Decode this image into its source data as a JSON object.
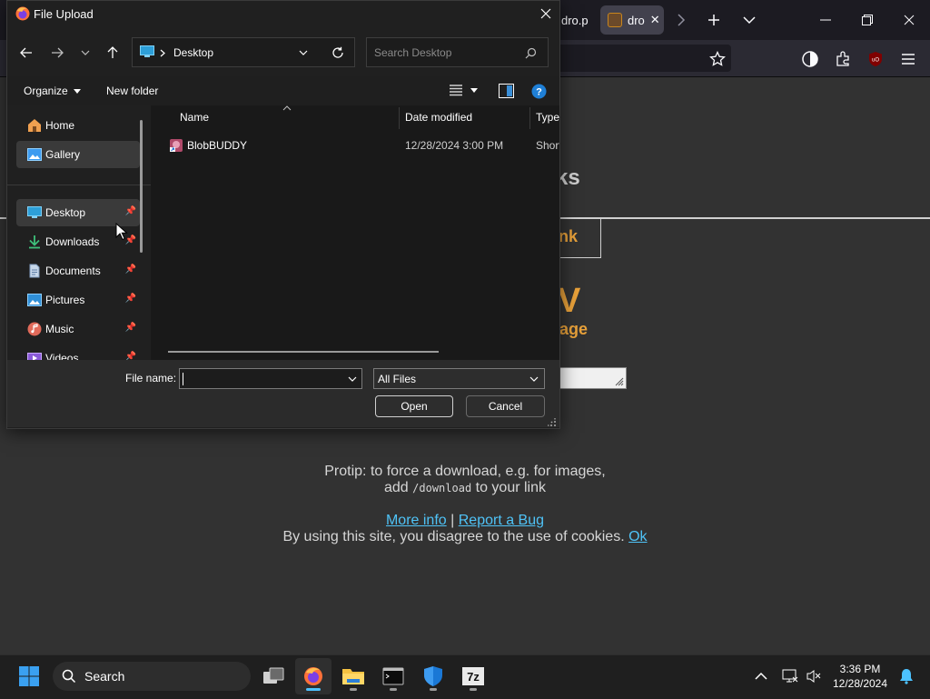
{
  "browser": {
    "tabs": [
      {
        "label": "dro.p",
        "active": false
      },
      {
        "label": "dro",
        "active": true
      }
    ],
    "accent": "#fbfbfe"
  },
  "page": {
    "heading_fragment": "ks",
    "link_box_fragment": "nk",
    "big_fragment": "V",
    "sub_fragment": "age",
    "protip_line1": "Protip: to force a download, e.g. for images,",
    "protip_add": "add",
    "protip_code": "/download",
    "protip_line2_end": "to your link",
    "more_info": "More info",
    "separator": "|",
    "report_bug": "Report a Bug",
    "cookie_text": "By using this site, you disagree to the use of cookies.",
    "cookie_ok": "Ok",
    "accent_orange": "#e8a13a",
    "link_color": "#4fc3f7"
  },
  "dialog": {
    "title": "File Upload",
    "breadcrumb": "Desktop",
    "search_placeholder": "Search Desktop",
    "organize_label": "Organize",
    "new_folder_label": "New folder",
    "nav_items": [
      {
        "label": "Home",
        "icon": "home-icon",
        "pinned": false,
        "selected": false
      },
      {
        "label": "Gallery",
        "icon": "gallery-icon",
        "pinned": false,
        "selected": true
      },
      {
        "label": "Desktop",
        "icon": "desktop-icon",
        "pinned": true,
        "selected": true
      },
      {
        "label": "Downloads",
        "icon": "download-icon",
        "pinned": true,
        "selected": false
      },
      {
        "label": "Documents",
        "icon": "document-icon",
        "pinned": true,
        "selected": false
      },
      {
        "label": "Pictures",
        "icon": "picture-icon",
        "pinned": true,
        "selected": false
      },
      {
        "label": "Music",
        "icon": "music-icon",
        "pinned": true,
        "selected": false
      },
      {
        "label": "Videos",
        "icon": "video-icon",
        "pinned": true,
        "selected": false
      }
    ],
    "columns": {
      "name": "Name",
      "date": "Date modified",
      "type": "Type"
    },
    "files": [
      {
        "name": "BlobBUDDY",
        "date": "12/28/2024 3:00 PM",
        "type": "Short"
      }
    ],
    "file_name_label": "File name:",
    "file_name_value": "",
    "file_type": "All Files",
    "open_label": "Open",
    "cancel_label": "Cancel"
  },
  "taskbar": {
    "search_label": "Search",
    "time": "3:36 PM",
    "date": "12/28/2024"
  }
}
